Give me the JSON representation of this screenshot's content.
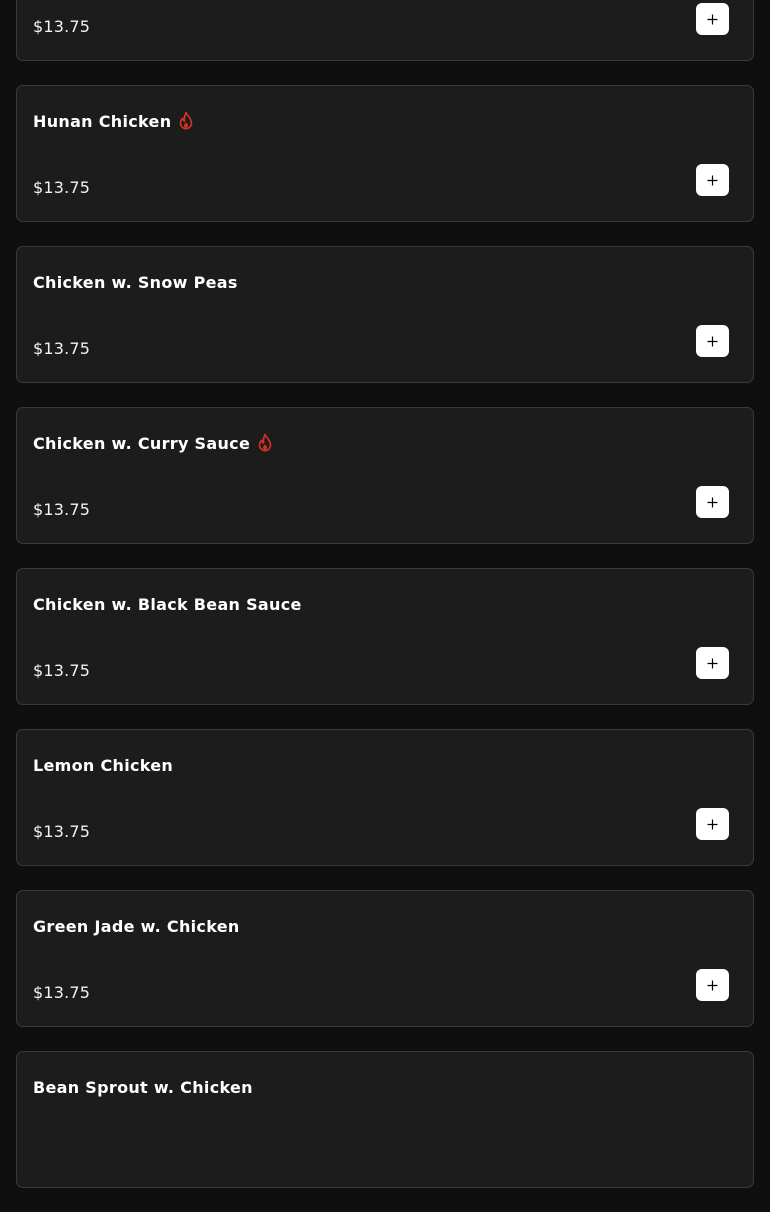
{
  "menu": {
    "items": [
      {
        "name": "",
        "spicy": false,
        "price": "$13.75"
      },
      {
        "name": "Hunan Chicken",
        "spicy": true,
        "price": "$13.75"
      },
      {
        "name": "Chicken w. Snow Peas",
        "spicy": false,
        "price": "$13.75"
      },
      {
        "name": "Chicken w. Curry Sauce",
        "spicy": true,
        "price": "$13.75"
      },
      {
        "name": "Chicken w. Black Bean Sauce",
        "spicy": false,
        "price": "$13.75"
      },
      {
        "name": "Lemon Chicken",
        "spicy": false,
        "price": "$13.75"
      },
      {
        "name": "Green Jade w. Chicken",
        "spicy": false,
        "price": "$13.75"
      },
      {
        "name": "Bean Sprout w. Chicken",
        "spicy": false,
        "price": ""
      }
    ]
  },
  "icons": {
    "spicy": "flame-icon",
    "add": "plus-icon"
  },
  "colors": {
    "background": "#0f0f0f",
    "card_background": "#1c1c1c",
    "card_border": "#3a3a3a",
    "spicy_icon": "#d93025",
    "add_button": "#ffffff"
  }
}
